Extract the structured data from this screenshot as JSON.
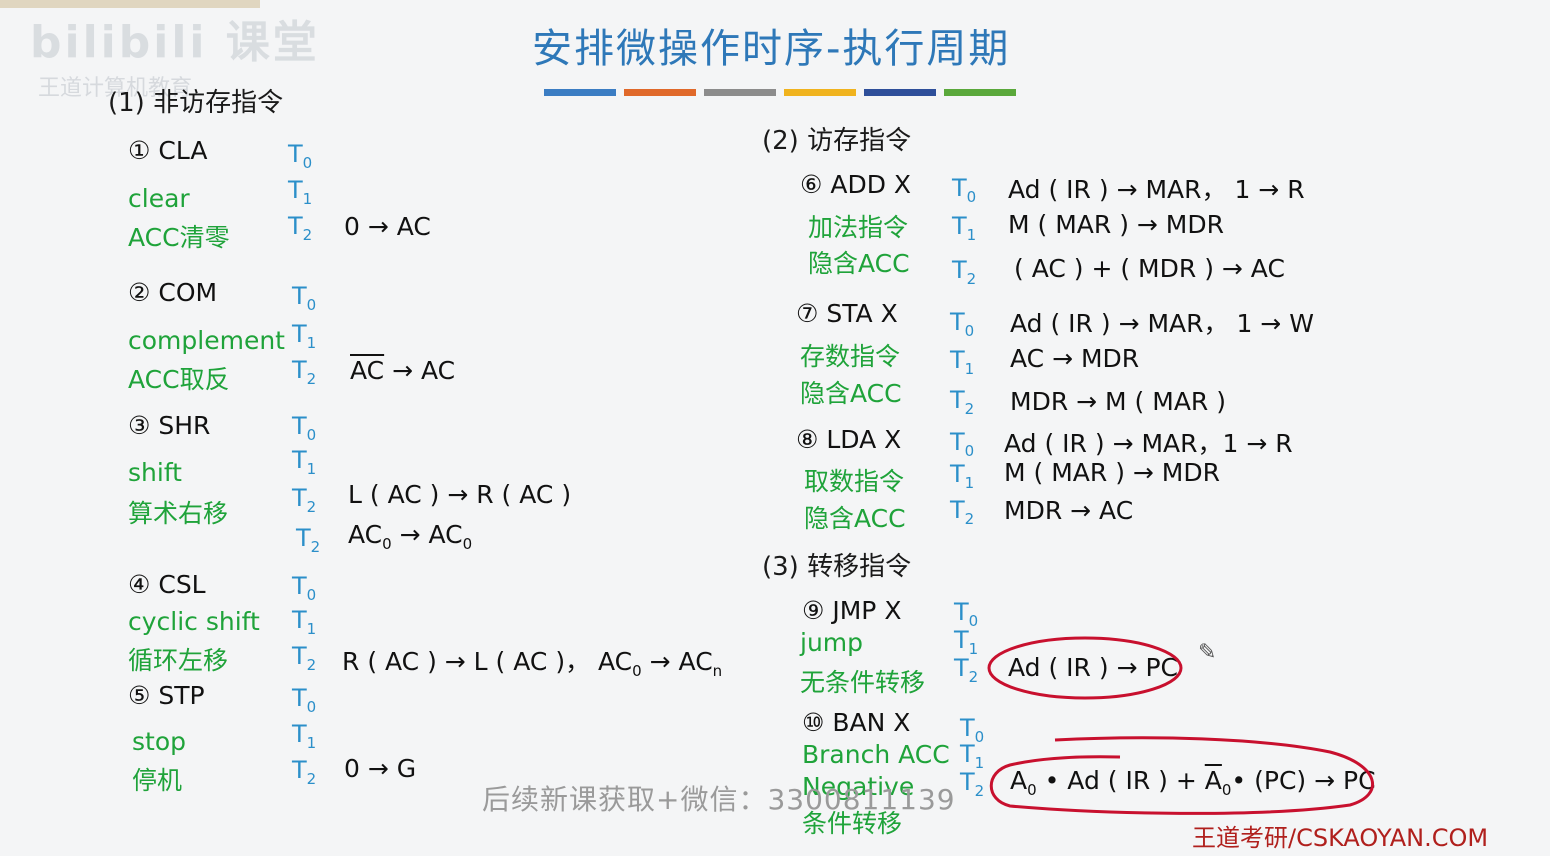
{
  "title": "安排微操作时序-执行周期",
  "colors": {
    "accent_bars": [
      "#3b7dc3",
      "#e0692a",
      "#8c8c8c",
      "#f0b31e",
      "#2e4f9a",
      "#5aa83b"
    ]
  },
  "watermark": {
    "logo": "bilibili 课堂",
    "sub": "王道计算机教育"
  },
  "sections": {
    "non_memory": "(1) 非访存指令",
    "memory": "(2) 访存指令",
    "transfer": "(3) 转移指令"
  },
  "labels": {
    "t0": "T",
    "t1": "T",
    "t2": "T",
    "i0": "0",
    "i1": "1",
    "i2": "2"
  },
  "cla": {
    "name": "① CLA",
    "en": "clear",
    "cn": "ACC清零",
    "op2": "0 → AC"
  },
  "com": {
    "name": "② COM",
    "en": "complement",
    "cn": "ACC取反",
    "op2_over": "AC",
    "op2_rest": " → AC"
  },
  "shr": {
    "name": "③ SHR",
    "en": "shift",
    "cn": "算术右移",
    "op2": "L ( AC ) → R ( AC )",
    "op3_a": "AC",
    "op3_b": " → AC",
    "sub0": "0"
  },
  "csl": {
    "name": "④ CSL",
    "en": "cyclic shift",
    "cn": "循环左移",
    "op2_a": "R ( AC ) → L ( AC )，  AC",
    "op2_b": " → AC",
    "sub0": "0",
    "subn": "n"
  },
  "stp": {
    "name": "⑤ STP",
    "en": "stop",
    "cn": "停机",
    "op2": "0 → G"
  },
  "add": {
    "name": "⑥ ADD  X",
    "cn": "加法指令",
    "cn2": "隐含ACC",
    "op0": "Ad ( IR ) → MAR，  1 → R",
    "op1": "M ( MAR ) → MDR",
    "op2": "( AC ) + ( MDR ) → AC"
  },
  "sta": {
    "name": "⑦ STA  X",
    "cn": "存数指令",
    "cn2": "隐含ACC",
    "op0": "Ad ( IR ) → MAR，  1 → W",
    "op1": "AC → MDR",
    "op2": "MDR → M ( MAR )"
  },
  "lda": {
    "name": "⑧ LDA  X",
    "cn": "取数指令",
    "cn2": "隐含ACC",
    "op0": "Ad ( IR ) → MAR，1 → R",
    "op1": "M ( MAR ) → MDR",
    "op2": "MDR → AC"
  },
  "jmp": {
    "name": "⑨ JMP  X",
    "en": "jump",
    "cn": "无条件转移",
    "op2": "Ad ( IR ) → PC"
  },
  "ban": {
    "name": "⑩ BAN  X",
    "en": "Branch ACC",
    "en2": "Negative",
    "cn": "条件转移",
    "a": "A",
    "s0": "0",
    "mid": " • Ad ( IR ) + ",
    "a_over": "A",
    "tail": "• (PC) → PC"
  },
  "overlay_text": "后续新课获取+微信：3300811139",
  "footer": "王道考研/CSKAOYAN.COM",
  "pencil_icon": "pencil-icon"
}
